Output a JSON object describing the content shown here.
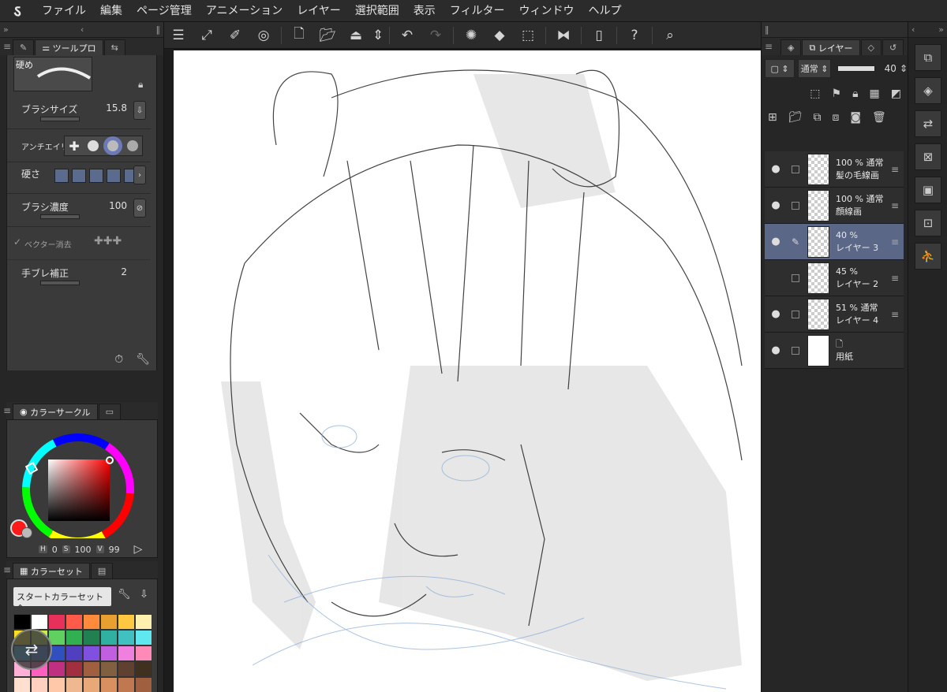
{
  "app": {
    "logo": "ऽ"
  },
  "menu": [
    "ファイル",
    "編集",
    "ページ管理",
    "アニメーション",
    "レイヤー",
    "選択範囲",
    "表示",
    "フィルター",
    "ウィンドウ",
    "ヘルプ"
  ],
  "tool_panel": {
    "tab_label": "ツールプロ",
    "brush_name": "硬め",
    "brush_size_label": "ブラシサイズ",
    "brush_size_value": "15.8",
    "antialias_label": "アンチエイリ",
    "hardness_label": "硬さ",
    "density_label": "ブラシ濃度",
    "density_value": "100",
    "vector_erase_label": "ベクター消去",
    "stabilization_label": "手ブレ補正",
    "stabilization_value": "2"
  },
  "color_circle": {
    "tab_label": "カラーサークル",
    "h_label": "H",
    "h_value": "0",
    "s_label": "S",
    "s_value": "100",
    "v_label": "V",
    "v_value": "99",
    "main_color": "#ff1a1a"
  },
  "color_set": {
    "tab_label": "カラーセット",
    "set_name": "スタートカラーセット",
    "swatches": [
      "#000000",
      "#ffffff",
      "#e8315a",
      "#ff5a4a",
      "#ff8a3a",
      "#e8a030",
      "#ffc840",
      "#fff0b0",
      "#ffe020",
      "#c8f040",
      "#60d060",
      "#30b050",
      "#208050",
      "#30b0a0",
      "#40c0c0",
      "#60e8f0",
      "#40b8ff",
      "#4080f0",
      "#3050c0",
      "#5040c0",
      "#8050e0",
      "#c060e0",
      "#f080e0",
      "#ff8ab8",
      "#ffb0d8",
      "#ff60c0",
      "#c03080",
      "#a03040",
      "#a06040",
      "#806040",
      "#604030",
      "#403020",
      "#ffe0d0",
      "#ffd0c0",
      "#ffc8a8",
      "#f0b890",
      "#e8a878",
      "#d89060",
      "#c07850",
      "#a06040"
    ]
  },
  "layers": {
    "tab_label": "レイヤー",
    "blend_mode": "通常",
    "opacity": "40",
    "items": [
      {
        "visible": "●",
        "opacity_blend": "100 % 通常",
        "name": "髪の毛線画"
      },
      {
        "visible": "●",
        "opacity_blend": "100 % 通常",
        "name": "顔線画"
      },
      {
        "visible": "●",
        "opacity_blend": "40 %",
        "name": "レイヤー 3"
      },
      {
        "visible": "",
        "opacity_blend": "45 %",
        "name": "レイヤー 2"
      },
      {
        "visible": "●",
        "opacity_blend": "51 % 通常",
        "name": "レイヤー 4"
      },
      {
        "visible": "●",
        "opacity_blend": "",
        "name": "用紙"
      }
    ]
  }
}
